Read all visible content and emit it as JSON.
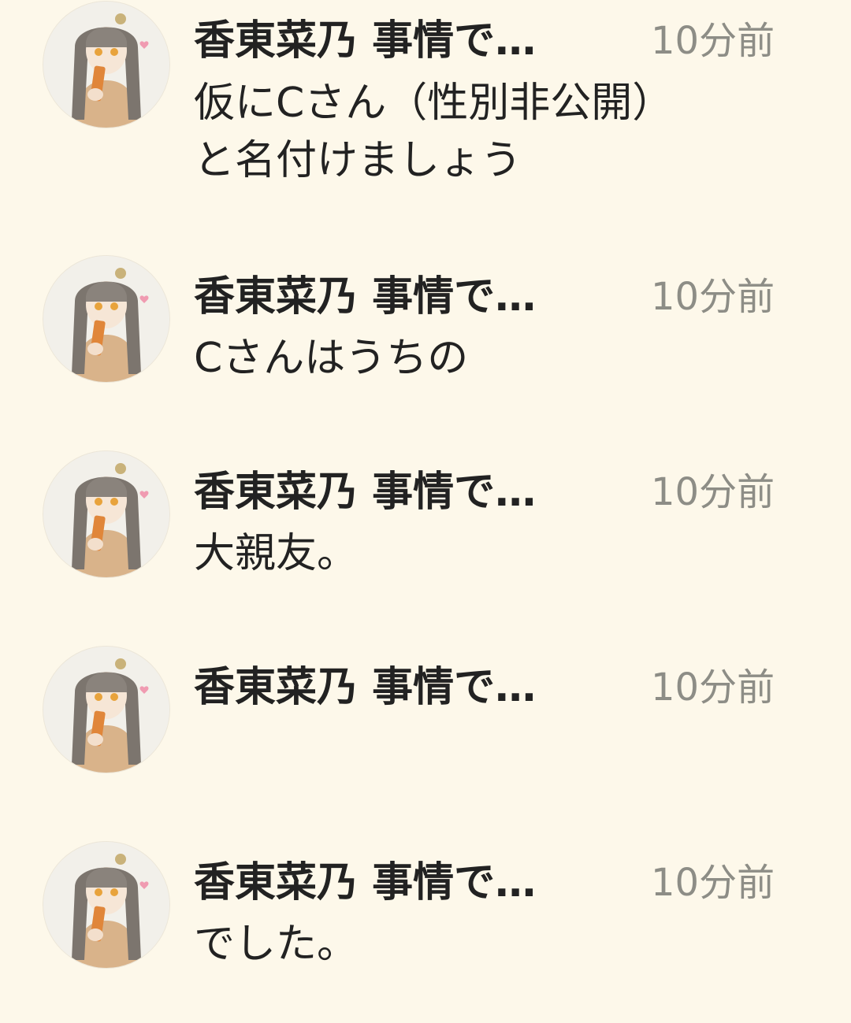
{
  "colors": {
    "background": "#fdf8ea",
    "text": "#222222",
    "timestamp": "#8d8d86"
  },
  "messages": [
    {
      "avatar_icon": "user-avatar-illustration",
      "sender": "香東菜乃 事情で…",
      "time": "10分前",
      "text": "仮にCさん（性別非公開）\nと名付けましょう"
    },
    {
      "avatar_icon": "user-avatar-illustration",
      "sender": "香東菜乃 事情で…",
      "time": "10分前",
      "text": "Cさんはうちの"
    },
    {
      "avatar_icon": "user-avatar-illustration",
      "sender": "香東菜乃 事情で…",
      "time": "10分前",
      "text": "大親友。"
    },
    {
      "avatar_icon": "user-avatar-illustration",
      "sender": "香東菜乃 事情で…",
      "time": "10分前",
      "text": ""
    },
    {
      "avatar_icon": "user-avatar-illustration",
      "sender": "香東菜乃 事情で…",
      "time": "10分前",
      "text": "でした。"
    }
  ]
}
